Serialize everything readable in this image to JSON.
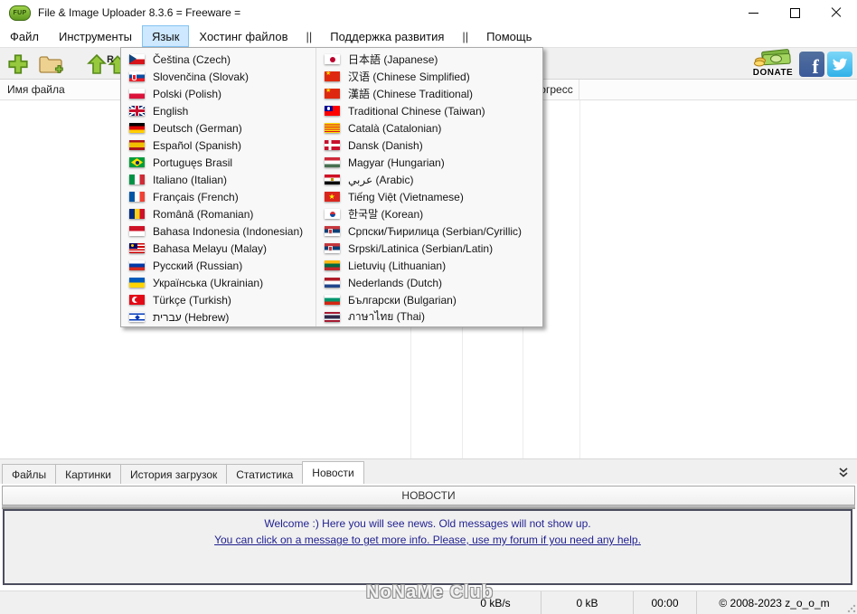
{
  "window": {
    "title": "File & Image Uploader 8.3.6  = Freeware =",
    "app_icon_text": "FUP"
  },
  "menubar": {
    "items": [
      {
        "label": "Файл"
      },
      {
        "label": "Инструменты"
      },
      {
        "label": "Язык",
        "active": true
      },
      {
        "label": "Хостинг файлов"
      },
      {
        "label": "||",
        "divider": true
      },
      {
        "label": "Поддержка развития"
      },
      {
        "label": "||",
        "divider": true
      },
      {
        "label": "Помощь"
      }
    ]
  },
  "toolbar": {
    "donate_label": "DONATE"
  },
  "language_menu": {
    "left": [
      {
        "label": "Čeština (Czech)",
        "flag": "czech"
      },
      {
        "label": "Slovenčina (Slovak)",
        "flag": "slovak"
      },
      {
        "label": "Polski (Polish)",
        "flag": "poland"
      },
      {
        "label": "English",
        "flag": "uk"
      },
      {
        "label": "Deutsch (German)",
        "flag": "germany"
      },
      {
        "label": "Español (Spanish)",
        "flag": "spain"
      },
      {
        "label": "Portuguęs Brasil",
        "flag": "brazil"
      },
      {
        "label": "Italiano (Italian)",
        "flag": "italy"
      },
      {
        "label": "Français (French)",
        "flag": "france"
      },
      {
        "label": "Română (Romanian)",
        "flag": "romania"
      },
      {
        "label": "Bahasa Indonesia (Indonesian)",
        "flag": "indonesia"
      },
      {
        "label": "Bahasa Melayu (Malay)",
        "flag": "malaysia"
      },
      {
        "label": "Русский (Russian)",
        "flag": "russia"
      },
      {
        "label": "Українська (Ukrainian)",
        "flag": "ukraine"
      },
      {
        "label": "Türkçe (Turkish)",
        "flag": "turkey"
      },
      {
        "label": "עברית (Hebrew)",
        "flag": "israel"
      }
    ],
    "right": [
      {
        "label": "日本語 (Japanese)",
        "flag": "japan"
      },
      {
        "label": "汉语 (Chinese Simplified)",
        "flag": "china"
      },
      {
        "label": "漢語 (Chinese Traditional)",
        "flag": "china"
      },
      {
        "label": "Traditional Chinese (Taiwan)",
        "flag": "taiwan"
      },
      {
        "label": "Català (Catalonian)",
        "flag": "catalonia"
      },
      {
        "label": "Dansk (Danish)",
        "flag": "denmark"
      },
      {
        "label": "Magyar (Hungarian)",
        "flag": "hungary"
      },
      {
        "label": "عربي (Arabic)",
        "flag": "egypt"
      },
      {
        "label": "Tiếng Việt (Vietnamese)",
        "flag": "vietnam"
      },
      {
        "label": "한국말 (Korean)",
        "flag": "korea"
      },
      {
        "label": "Српски/Ћирилица (Serbian/Cyrillic)",
        "flag": "serbia"
      },
      {
        "label": "Srpski/Latinica (Serbian/Latin)",
        "flag": "serbia"
      },
      {
        "label": "Lietuvių (Lithuanian)",
        "flag": "lithuania"
      },
      {
        "label": "Nederlands (Dutch)",
        "flag": "netherlands"
      },
      {
        "label": "Български (Bulgarian)",
        "flag": "bulgaria"
      },
      {
        "label": "ภาษาไทย (Thai)",
        "flag": "thailand"
      }
    ]
  },
  "table": {
    "col_filename": "Имя файла",
    "col_progress": "Прогресс"
  },
  "tabs": {
    "items": [
      {
        "label": "Файлы"
      },
      {
        "label": "Картинки"
      },
      {
        "label": "История загрузок"
      },
      {
        "label": "Статистика"
      },
      {
        "label": "Новости",
        "active": true
      }
    ]
  },
  "news": {
    "header": "НОВОСТИ",
    "line1": "Welcome :) Here you will see news. Old messages will not show up.",
    "line2": "You can click on a message to get more info. Please, use my forum if you need any help."
  },
  "watermark": "NoNaMe Club",
  "status": {
    "speed": "0 kB/s",
    "size": "0 kB",
    "time": "00:00",
    "copyright": "© 2008-2023 z_o_o_m"
  }
}
